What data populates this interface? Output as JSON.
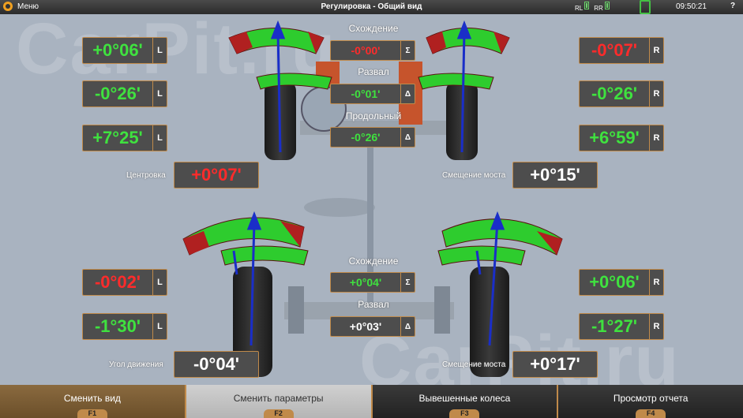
{
  "topbar": {
    "menu_label": "Меню",
    "title": "Регулировка - Общий вид",
    "sensor_rl": "RL",
    "sensor_rr": "RR",
    "time": "09:50:21",
    "help": "?"
  },
  "watermark": {
    "top": "CarPit.ru",
    "bottom": "CarPit.ru"
  },
  "front": {
    "left": {
      "toe": "+0°06'",
      "camber": "-0°26'",
      "caster": "+7°25'",
      "side": "L"
    },
    "right": {
      "toe": "-0°07'",
      "camber": "-0°26'",
      "caster": "+6°59'",
      "side": "R"
    },
    "center": {
      "toe_label": "Схождение",
      "toe_value": "-0°00'",
      "toe_symbol": "Σ",
      "camber_label": "Развал",
      "camber_value": "-0°01'",
      "camber_symbol": "Δ",
      "caster_label": "Продольный",
      "caster_value": "-0°26'",
      "caster_symbol": "Δ"
    },
    "centering_label": "Центровка",
    "centering_value": "+0°07'",
    "setback_label": "Смещение моста",
    "setback_value": "+0°15'"
  },
  "rear": {
    "left": {
      "toe": "-0°02'",
      "camber": "-1°30'",
      "side": "L"
    },
    "right": {
      "toe": "+0°06'",
      "camber": "-1°27'",
      "side": "R"
    },
    "center": {
      "toe_label": "Схождение",
      "toe_value": "+0°04'",
      "toe_symbol": "Σ",
      "camber_label": "Развал",
      "camber_value": "+0°03'",
      "camber_symbol": "Δ"
    },
    "thrust_label": "Угол движения",
    "thrust_value": "-0°04'",
    "setback_label": "Смещение моста",
    "setback_value": "+0°17'"
  },
  "fbar": [
    {
      "label": "Сменить вид",
      "key": "F1"
    },
    {
      "label": "Сменить параметры",
      "key": "F2"
    },
    {
      "label": "Вывешенные колеса",
      "key": "F3"
    },
    {
      "label": "Просмотр отчета",
      "key": "F4"
    }
  ],
  "colors": {
    "good": "#3fe23f",
    "bad": "#ff2b2b",
    "accent": "#c08a4a"
  }
}
